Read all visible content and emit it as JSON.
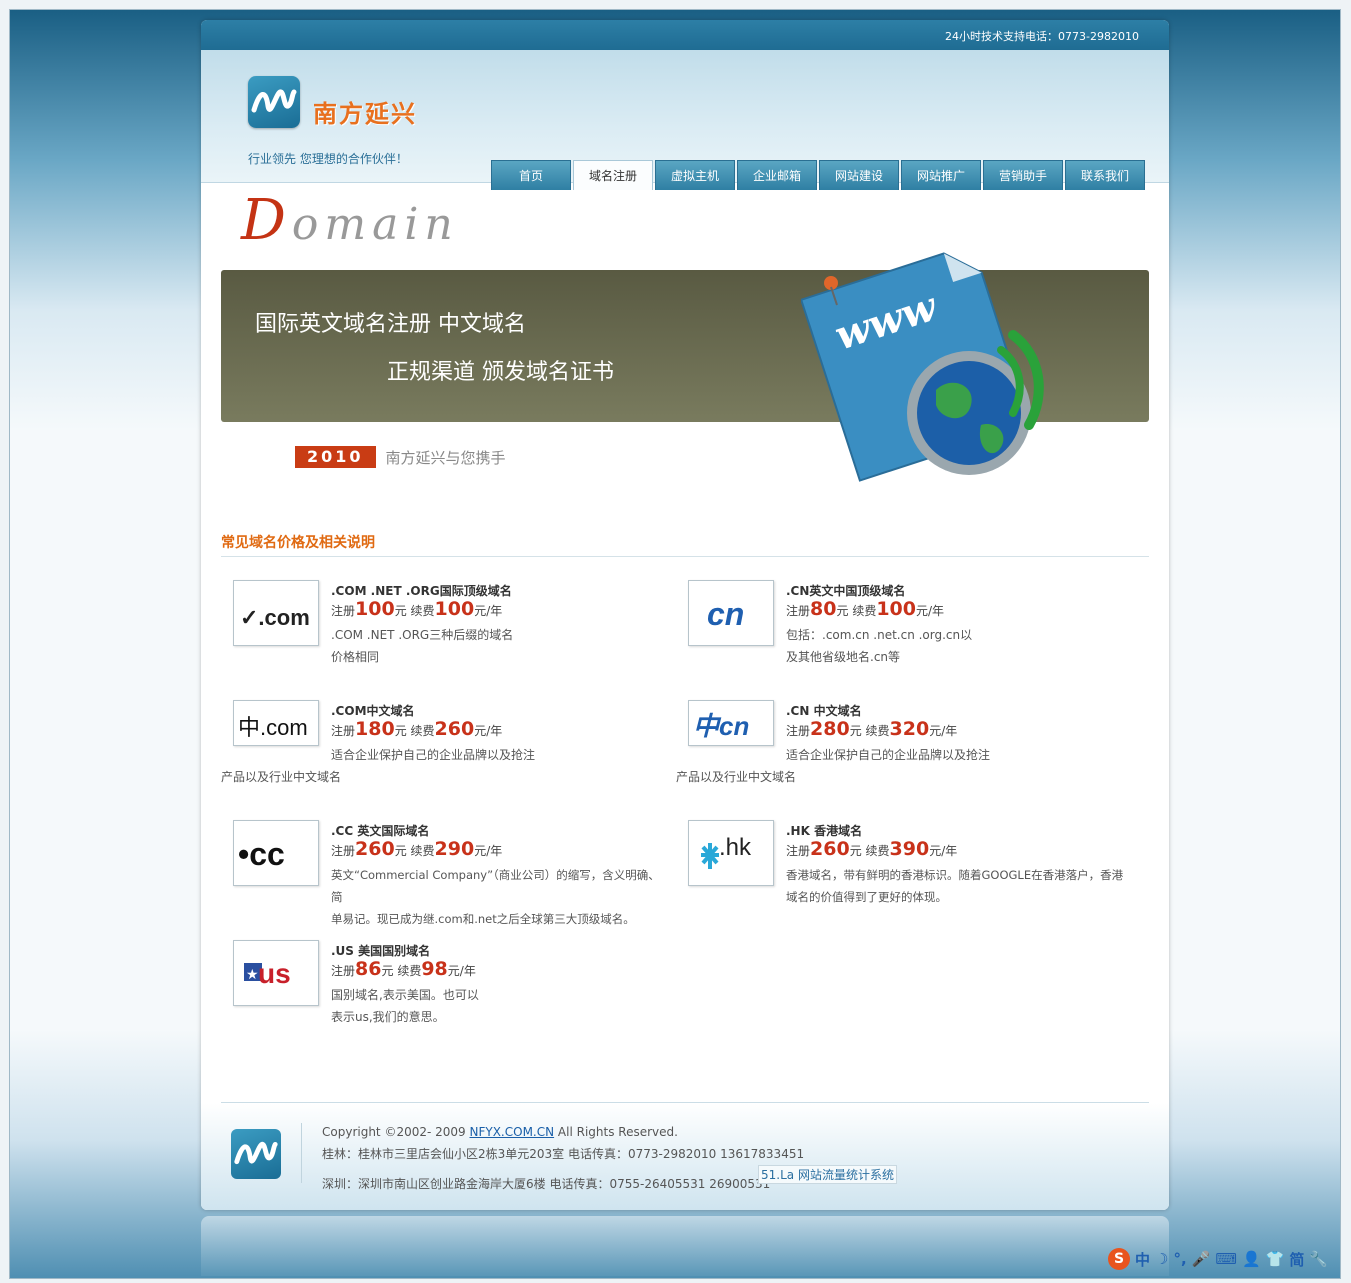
{
  "topbar": {
    "support": "24小时技术支持电话：0773-2982010"
  },
  "brand": {
    "name": "南方延兴",
    "slogan": "行业领先 您理想的合作伙伴！"
  },
  "nav": [
    {
      "label": "首页"
    },
    {
      "label": "域名注册"
    },
    {
      "label": "虚拟主机"
    },
    {
      "label": "企业邮箱"
    },
    {
      "label": "网站建设"
    },
    {
      "label": "网站推广"
    },
    {
      "label": "营销助手"
    },
    {
      "label": "联系我们"
    }
  ],
  "hero": {
    "domain_first": "D",
    "domain_rest": "omain",
    "line1": "国际英文域名注册  中文域名",
    "line2": "正规渠道  颁发域名证书",
    "year": "2010",
    "tagline": "南方延兴与您携手",
    "www": "www"
  },
  "section_title": "常见域名价格及相关说明",
  "labels": {
    "register": "注册",
    "yuan": "元",
    "renew": "续费",
    "per_year": "元/年"
  },
  "domains": [
    {
      "thumb": "✓.com",
      "name": ".COM .NET .ORG国际顶级域名",
      "register": "100",
      "renew": "100",
      "desc1": ".COM .NET .ORG三种后缀的域名",
      "desc2": "价格相同"
    },
    {
      "thumb": "cn",
      "name": ".CN英文中国顶级域名",
      "register": "80",
      "renew": "100",
      "desc1": "包括：.com.cn .net.cn .org.cn以",
      "desc2": "及其他省级地名.cn等"
    },
    {
      "thumb": "中.com",
      "name": ".COM中文域名",
      "register": "180",
      "renew": "260",
      "desc1": "适合企业保护自己的企业品牌以及抢注",
      "desc2": "产品以及行业中文域名"
    },
    {
      "thumb": "中cn",
      "name": ".CN 中文域名",
      "register": "280",
      "renew": "320",
      "desc1": "适合企业保护自己的企业品牌以及抢注",
      "desc2": "产品以及行业中文域名"
    },
    {
      "thumb": "•cc",
      "name": ".CC 英文国际域名",
      "register": "260",
      "renew": "290",
      "desc1": "英文“Commercial Company”（商业公司）的缩写，含义明确、简",
      "desc2": "单易记。现已成为继.com和.net之后全球第三大顶级域名。"
    },
    {
      "thumb": ".hk",
      "name": ".HK 香港域名",
      "register": "260",
      "renew": "390",
      "desc1": "香港域名，带有鲜明的香港标识。随着GOOGLE在香港落户，香港",
      "desc2": "域名的价值得到了更好的体现。"
    },
    {
      "thumb": "us",
      "name": ".US 美国国别域名",
      "register": "86",
      "renew": "98",
      "desc1": "国别域名,表示美国。也可以",
      "desc2": "表示us,我们的意思。"
    }
  ],
  "footer": {
    "copyright_pre": "Copyright ©2002- 2009 ",
    "copyright_link": "NFYX.COM.CN",
    "copyright_post": " All Rights Reserved.",
    "guilin": "桂林：桂林市三里店会仙小区2栋3单元203室 电话传真：0773-2982010 13617833451",
    "shenzhen": "深圳：深圳市南山区创业路金海岸大厦6楼 电话传真：0755-26405531 26900531",
    "stat": "51.La 网站流量统计系统"
  },
  "ime": {
    "items": [
      "中",
      "☽",
      "°,",
      "🎤",
      "⌨",
      "👤",
      "👕",
      "简",
      "🔧"
    ]
  },
  "colors": {
    "accent": "#e06a12",
    "price": "#c8321a",
    "nav": "#2f7fa3",
    "year_badge": "#c93c14"
  }
}
